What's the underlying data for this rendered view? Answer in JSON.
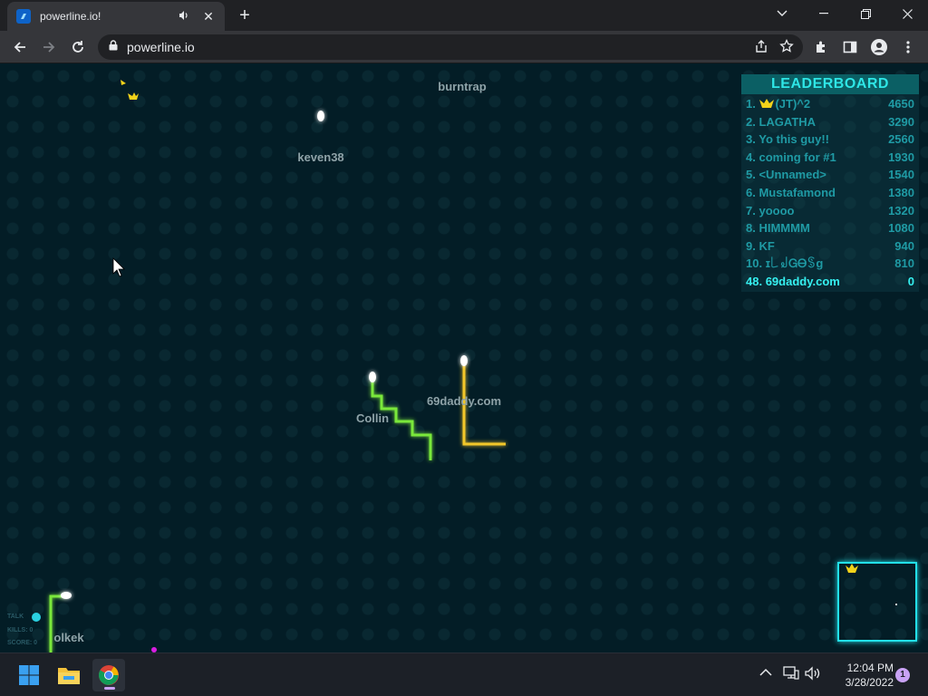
{
  "browser": {
    "tab_title": "powerline.io!",
    "url": "powerline.io",
    "audio_icon": "speaker-icon",
    "close_icon": "close-icon",
    "newtab_icon": "plus-icon"
  },
  "game": {
    "players": [
      {
        "name": "burntrap",
        "color": "#d81ee0"
      },
      {
        "name": "keven38",
        "color": "#3ee7c9"
      },
      {
        "name": "Collin",
        "color": "#7ae83a"
      },
      {
        "name": "69daddy.com",
        "color": "#f2c72a"
      },
      {
        "name": "olkek",
        "color": "#7ae83a"
      }
    ],
    "leaderboard": {
      "title": "LEADERBOARD",
      "rows": [
        {
          "rank": "1.",
          "name": "(JT)^2",
          "score": "4650",
          "crown": true
        },
        {
          "rank": "2.",
          "name": "LAGATHA",
          "score": "3290"
        },
        {
          "rank": "3.",
          "name": "Yo this guy!!",
          "score": "2560"
        },
        {
          "rank": "4.",
          "name": "coming for #1",
          "score": "1930"
        },
        {
          "rank": "5.",
          "name": "<Unnamed>",
          "score": "1540"
        },
        {
          "rank": "6.",
          "name": "Mustafamond",
          "score": "1380"
        },
        {
          "rank": "7.",
          "name": "yoooo",
          "score": "1320"
        },
        {
          "rank": "8.",
          "name": "HIMMMM",
          "score": "1080"
        },
        {
          "rank": "9.",
          "name": "KF",
          "score": "940"
        },
        {
          "rank": "10.",
          "name": "ɪ꒒꒻ᏀᎾꌗg",
          "score": "810"
        }
      ],
      "me": {
        "rank": "48.",
        "name": "69daddy.com",
        "score": "0"
      }
    },
    "stats": {
      "talk": "TALK",
      "kills": "KILLS: 0",
      "score": "SCORE: 0"
    }
  },
  "taskbar": {
    "time": "12:04 PM",
    "date": "3/28/2022",
    "notification_count": "1"
  }
}
